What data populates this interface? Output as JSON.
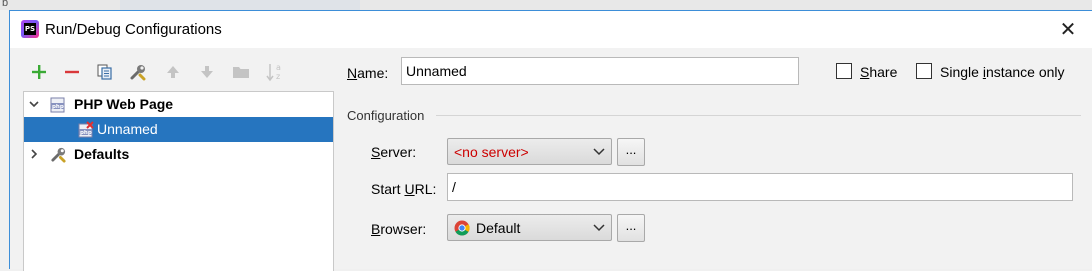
{
  "background": {
    "fragment": "b"
  },
  "dialog": {
    "title": "Run/Debug Configurations",
    "app_icon_text": "PS",
    "close_glyph": "✕"
  },
  "toolbar": {
    "items": [
      {
        "name": "add",
        "icon": "plus-icon",
        "color": "#3aaa35"
      },
      {
        "name": "remove",
        "icon": "minus-icon",
        "color": "#d9383a"
      },
      {
        "name": "copy",
        "icon": "copy-icon"
      },
      {
        "name": "edit-defaults",
        "icon": "wrench-icon"
      },
      {
        "name": "move-up",
        "icon": "arrow-up-icon",
        "disabled": true
      },
      {
        "name": "move-down",
        "icon": "arrow-down-icon",
        "disabled": true
      },
      {
        "name": "folder",
        "icon": "folder-icon",
        "disabled": true
      },
      {
        "name": "sort",
        "icon": "sort-az-icon",
        "disabled": true
      }
    ]
  },
  "tree": {
    "php_web_page": {
      "label": "PHP Web Page",
      "expanded": true,
      "icon": "php-icon"
    },
    "unnamed": {
      "label": "Unnamed",
      "selected": true,
      "icon": "php-error-icon"
    },
    "defaults": {
      "label": "Defaults",
      "expanded": false,
      "icon": "wrench-icon"
    }
  },
  "form": {
    "name_label_u": "N",
    "name_label_rest": "ame:",
    "name_value": "Unnamed",
    "share_label_u": "S",
    "share_label_rest": "hare",
    "share_checked": false,
    "single_label_pre": "Single ",
    "single_label_u": "i",
    "single_label_rest": "nstance only",
    "single_checked": false,
    "section_title": "Configuration",
    "server_label_u": "S",
    "server_label_rest": "erver:",
    "server_value": "<no server>",
    "server_value_color": "#cc0000",
    "server_btn": "...",
    "start_url_label_pre": "Start ",
    "start_url_label_u": "U",
    "start_url_label_rest": "RL:",
    "start_url_value": "/",
    "browser_label_u": "B",
    "browser_label_rest": "rowser:",
    "browser_value": "Default",
    "browser_icon": "chrome-icon",
    "browser_btn": "..."
  },
  "colors": {
    "accent": "#3d8ed8",
    "selection": "#2675bf"
  }
}
